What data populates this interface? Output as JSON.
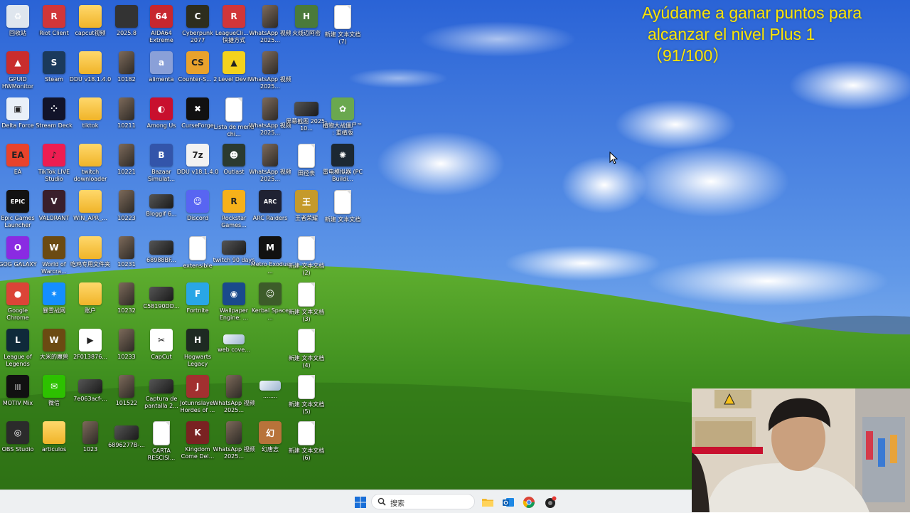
{
  "overlay": {
    "line1": "Ayúdame a ganar puntos para",
    "line2": "alcanzar el nivel Plus 1",
    "line3": "（91/100）",
    "color": "#ffe600"
  },
  "taskbar": {
    "search_placeholder": "搜索",
    "items": [
      "start-icon",
      "search-icon",
      "file-explorer-icon",
      "outlook-icon",
      "chrome-icon",
      "app-icon"
    ]
  },
  "desktop_icons": [
    {
      "label": "回收站",
      "icon": "recycle-bin-icon",
      "type": "app",
      "color": "#dfe6ee",
      "glyph": "♻"
    },
    {
      "label": "Riot Client",
      "icon": "riot-icon",
      "type": "circle",
      "color": "#d13639",
      "glyph": "R"
    },
    {
      "label": "capcut视频",
      "icon": "folder-icon",
      "type": "folder"
    },
    {
      "label": "2025.8",
      "icon": "folder-dark-icon",
      "type": "app",
      "color": "#333333",
      "glyph": ""
    },
    {
      "label": "AIDA64 Extreme",
      "icon": "aida64-icon",
      "type": "app",
      "color": "#c7272f",
      "glyph": "64"
    },
    {
      "label": "Cyberpunk 2077",
      "icon": "cyberpunk-icon",
      "type": "circle",
      "color": "#2d2d1e",
      "glyph": "C"
    },
    {
      "label": "LeagueCli... - 快捷方式",
      "icon": "riot-icon",
      "type": "circle",
      "color": "#d13639",
      "glyph": "R"
    },
    {
      "label": "WhatsApp 视频2025...",
      "icon": "video-icon",
      "type": "photo"
    },
    {
      "label": "火线迈阿密",
      "icon": "game-icon",
      "type": "app",
      "color": "#4a7a3a",
      "glyph": "H"
    },
    {
      "label": "新建 文本文档 (7)",
      "icon": "text-doc-icon",
      "type": "doc"
    },
    {
      "label": "GPUID HWMonitor",
      "icon": "hwmonitor-icon",
      "type": "app",
      "color": "#c92d2d",
      "glyph": "▲"
    },
    {
      "label": "Steam",
      "icon": "steam-icon",
      "type": "circle",
      "color": "#1b3a5c",
      "glyph": "S"
    },
    {
      "label": "DDU v18.1.4.0",
      "icon": "folder-icon",
      "type": "folder"
    },
    {
      "label": "10182",
      "icon": "photo-icon",
      "type": "photo"
    },
    {
      "label": "alimenta",
      "icon": "alimenta-icon",
      "type": "app",
      "color": "#8aa0d8",
      "glyph": "a"
    },
    {
      "label": "Counter-S... 2",
      "icon": "cs2-icon",
      "type": "app",
      "color": "#e9a22c",
      "glyph": "CS"
    },
    {
      "label": "Level Devil",
      "icon": "level-devil-icon",
      "type": "app",
      "color": "#f4d21c",
      "glyph": "▲"
    },
    {
      "label": "WhatsApp 视频2025...",
      "icon": "video-icon",
      "type": "photo"
    },
    {
      "label": "",
      "icon": "",
      "type": "none"
    },
    {
      "label": "",
      "icon": "",
      "type": "none"
    },
    {
      "label": "Delta Force",
      "icon": "delta-force-icon",
      "type": "app",
      "color": "#e9f0f8",
      "glyph": "▣"
    },
    {
      "label": "Stream Deck",
      "icon": "stream-deck-icon",
      "type": "circle",
      "color": "#12142a",
      "glyph": "⁘"
    },
    {
      "label": "tiktok",
      "icon": "folder-icon",
      "type": "folder"
    },
    {
      "label": "10211",
      "icon": "photo-icon",
      "type": "photo"
    },
    {
      "label": "Among Us",
      "icon": "among-us-icon",
      "type": "app",
      "color": "#c8102e",
      "glyph": "◐"
    },
    {
      "label": "CurseForge",
      "icon": "curseforge-icon",
      "type": "app",
      "color": "#111111",
      "glyph": "✖"
    },
    {
      "label": "Lista de menú chi...",
      "icon": "text-doc-icon",
      "type": "doc"
    },
    {
      "label": "WhatsApp 视频2025...",
      "icon": "video-icon",
      "type": "photo"
    },
    {
      "label": "屏幕截图 2025-10...",
      "icon": "screenshot-icon",
      "type": "wide"
    },
    {
      "label": "植物大战僵尸™ : 重植版",
      "icon": "pvz-icon",
      "type": "app",
      "color": "#6aa84f",
      "glyph": "✿"
    },
    {
      "label": "EA",
      "icon": "ea-icon",
      "type": "circle",
      "color": "#e8432b",
      "glyph": "EA"
    },
    {
      "label": "TikTok LIVE Studio",
      "icon": "tiktok-icon",
      "type": "app",
      "color": "#ee1d52",
      "glyph": "♪"
    },
    {
      "label": "twitch downloader",
      "icon": "folder-icon",
      "type": "folder"
    },
    {
      "label": "10221",
      "icon": "photo-icon",
      "type": "photo"
    },
    {
      "label": "Bazaar Simulat...",
      "icon": "bazaar-icon",
      "type": "app",
      "color": "#3355aa",
      "glyph": "B"
    },
    {
      "label": "DDU v18.1.4.0",
      "icon": "7zip-icon",
      "type": "app",
      "color": "#f2f2f2",
      "glyph": "7z"
    },
    {
      "label": "Outlast",
      "icon": "outlast-icon",
      "type": "app",
      "color": "#2b3a30",
      "glyph": "☻"
    },
    {
      "label": "WhatsApp 视频2025...",
      "icon": "video-icon",
      "type": "photo"
    },
    {
      "label": "田径表",
      "icon": "text-doc-icon",
      "type": "doc"
    },
    {
      "label": "雷电模拟器 (PC Buildi...",
      "icon": "emulator-icon",
      "type": "circle",
      "color": "#1c2833",
      "glyph": "✺"
    },
    {
      "label": "Epic Games Launcher",
      "icon": "epic-icon",
      "type": "app",
      "color": "#121212",
      "glyph": "EPIC"
    },
    {
      "label": "VALORANT",
      "icon": "valorant-icon",
      "type": "app",
      "color": "#3a1f2b",
      "glyph": "V"
    },
    {
      "label": "WIN_APR_...",
      "icon": "folder-icon",
      "type": "folder"
    },
    {
      "label": "10223",
      "icon": "photo-icon",
      "type": "photo"
    },
    {
      "label": "Bloggif 6...",
      "icon": "bloggif-icon",
      "type": "wide"
    },
    {
      "label": "Discord",
      "icon": "discord-icon",
      "type": "circle",
      "color": "#5865f2",
      "glyph": "☺"
    },
    {
      "label": "Rockstar Games...",
      "icon": "rockstar-icon",
      "type": "app",
      "color": "#f6b11a",
      "glyph": "R"
    },
    {
      "label": "ARC Raiders",
      "icon": "arc-raiders-icon",
      "type": "app",
      "color": "#1f2233",
      "glyph": "ARC"
    },
    {
      "label": "王者荣耀",
      "icon": "game-icon",
      "type": "app",
      "color": "#c59a2b",
      "glyph": "王"
    },
    {
      "label": "新建 文本文档",
      "icon": "text-doc-icon",
      "type": "doc"
    },
    {
      "label": "GOG GALAXY",
      "icon": "gog-icon",
      "type": "circle",
      "color": "#8a2be2",
      "glyph": "O"
    },
    {
      "label": "World of Warcra...",
      "icon": "wow-icon",
      "type": "circle",
      "color": "#6b4a12",
      "glyph": "W"
    },
    {
      "label": "吃鸡专用文件夹",
      "icon": "folder-icon",
      "type": "folder"
    },
    {
      "label": "10231",
      "icon": "photo-icon",
      "type": "photo"
    },
    {
      "label": "68988BF...",
      "icon": "video-icon",
      "type": "wide"
    },
    {
      "label": "extensible",
      "icon": "text-doc-icon",
      "type": "doc"
    },
    {
      "label": "twitch 90 days",
      "icon": "twitch-icon",
      "type": "wide"
    },
    {
      "label": "Metro Exodus ...",
      "icon": "metro-icon",
      "type": "app",
      "color": "#111111",
      "glyph": "M"
    },
    {
      "label": "新建 文本文档 (2)",
      "icon": "text-doc-icon",
      "type": "doc"
    },
    {
      "label": "",
      "icon": "",
      "type": "none"
    },
    {
      "label": "Google Chrome",
      "icon": "chrome-icon",
      "type": "circle",
      "color": "#db4437",
      "glyph": "●"
    },
    {
      "label": "暴雪战网",
      "icon": "battlenet-icon",
      "type": "circle",
      "color": "#148eff",
      "glyph": "✶"
    },
    {
      "label": "账户",
      "icon": "folder-icon",
      "type": "folder"
    },
    {
      "label": "10232",
      "icon": "photo-icon",
      "type": "photo"
    },
    {
      "label": "C58190DD...",
      "icon": "video-icon",
      "type": "wide"
    },
    {
      "label": "Fortnite",
      "icon": "fortnite-icon",
      "type": "app",
      "color": "#29a6e6",
      "glyph": "F"
    },
    {
      "label": "Wallpaper Engine: ...",
      "icon": "wallpaper-engine-icon",
      "type": "app",
      "color": "#1a4a8c",
      "glyph": "◉"
    },
    {
      "label": "Kerbal Space ...",
      "icon": "kerbal-icon",
      "type": "app",
      "color": "#3d5c2a",
      "glyph": "☺"
    },
    {
      "label": "新建 文本文档 (3)",
      "icon": "text-doc-icon",
      "type": "doc"
    },
    {
      "label": "",
      "icon": "",
      "type": "none"
    },
    {
      "label": "League of Legends",
      "icon": "lol-icon",
      "type": "circle",
      "color": "#0f2a3a",
      "glyph": "L"
    },
    {
      "label": "大米的魔兽",
      "icon": "wow-icon",
      "type": "circle",
      "color": "#6b4a12",
      "glyph": "W"
    },
    {
      "label": "2F013876...",
      "icon": "video-file-icon",
      "type": "app",
      "color": "#ffffff",
      "glyph": "▶"
    },
    {
      "label": "10233",
      "icon": "photo-icon",
      "type": "photo"
    },
    {
      "label": "CapCut",
      "icon": "capcut-icon",
      "type": "app",
      "color": "#ffffff",
      "glyph": "✂"
    },
    {
      "label": "Hogwarts Legacy",
      "icon": "hogwarts-icon",
      "type": "app",
      "color": "#1e2a22",
      "glyph": "H"
    },
    {
      "label": "web cove...",
      "icon": "image-icon",
      "type": "wide2"
    },
    {
      "label": "",
      "icon": "",
      "type": "none"
    },
    {
      "label": "新建 文本文档 (4)",
      "icon": "text-doc-icon",
      "type": "doc"
    },
    {
      "label": "",
      "icon": "",
      "type": "none"
    },
    {
      "label": "MOTIV Mix",
      "icon": "motiv-mix-icon",
      "type": "app",
      "color": "#111111",
      "glyph": "|||"
    },
    {
      "label": "微信",
      "icon": "wechat-icon",
      "type": "app",
      "color": "#2dc100",
      "glyph": "✉"
    },
    {
      "label": "7e063acf-...",
      "icon": "image-icon",
      "type": "wide"
    },
    {
      "label": "101522",
      "icon": "photo-icon",
      "type": "photo"
    },
    {
      "label": "Captura de pantalla 2...",
      "icon": "screenshot-icon",
      "type": "wide"
    },
    {
      "label": "Jotunnslayer Hordes of ...",
      "icon": "jotunnslayer-icon",
      "type": "app",
      "color": "#a23030",
      "glyph": "J"
    },
    {
      "label": "WhatsApp 视频2025...",
      "icon": "video-icon",
      "type": "photo"
    },
    {
      "label": "........",
      "icon": "image-icon",
      "type": "wide2"
    },
    {
      "label": "新建 文本文档 (5)",
      "icon": "text-doc-icon",
      "type": "doc"
    },
    {
      "label": "",
      "icon": "",
      "type": "none"
    },
    {
      "label": "OBS Studio",
      "icon": "obs-icon",
      "type": "circle",
      "color": "#2b2b2b",
      "glyph": "◎"
    },
    {
      "label": "articulos",
      "icon": "folder-icon",
      "type": "folder"
    },
    {
      "label": "1023",
      "icon": "photo-icon",
      "type": "photo"
    },
    {
      "label": "6896277B-...",
      "icon": "image-icon",
      "type": "wide"
    },
    {
      "label": "CARTA RESCISI...",
      "icon": "chrome-doc-icon",
      "type": "doc"
    },
    {
      "label": "Kingdom Come Del...",
      "icon": "kingdom-come-icon",
      "type": "circle",
      "color": "#7a2222",
      "glyph": "K"
    },
    {
      "label": "WhatsApp 视频2025...",
      "icon": "video-icon",
      "type": "photo"
    },
    {
      "label": "幻唐志",
      "icon": "game-icon",
      "type": "app",
      "color": "#b8733a",
      "glyph": "幻"
    },
    {
      "label": "新建 文本文档 (6)",
      "icon": "text-doc-icon",
      "type": "doc"
    },
    {
      "label": "",
      "icon": "",
      "type": "none"
    }
  ]
}
